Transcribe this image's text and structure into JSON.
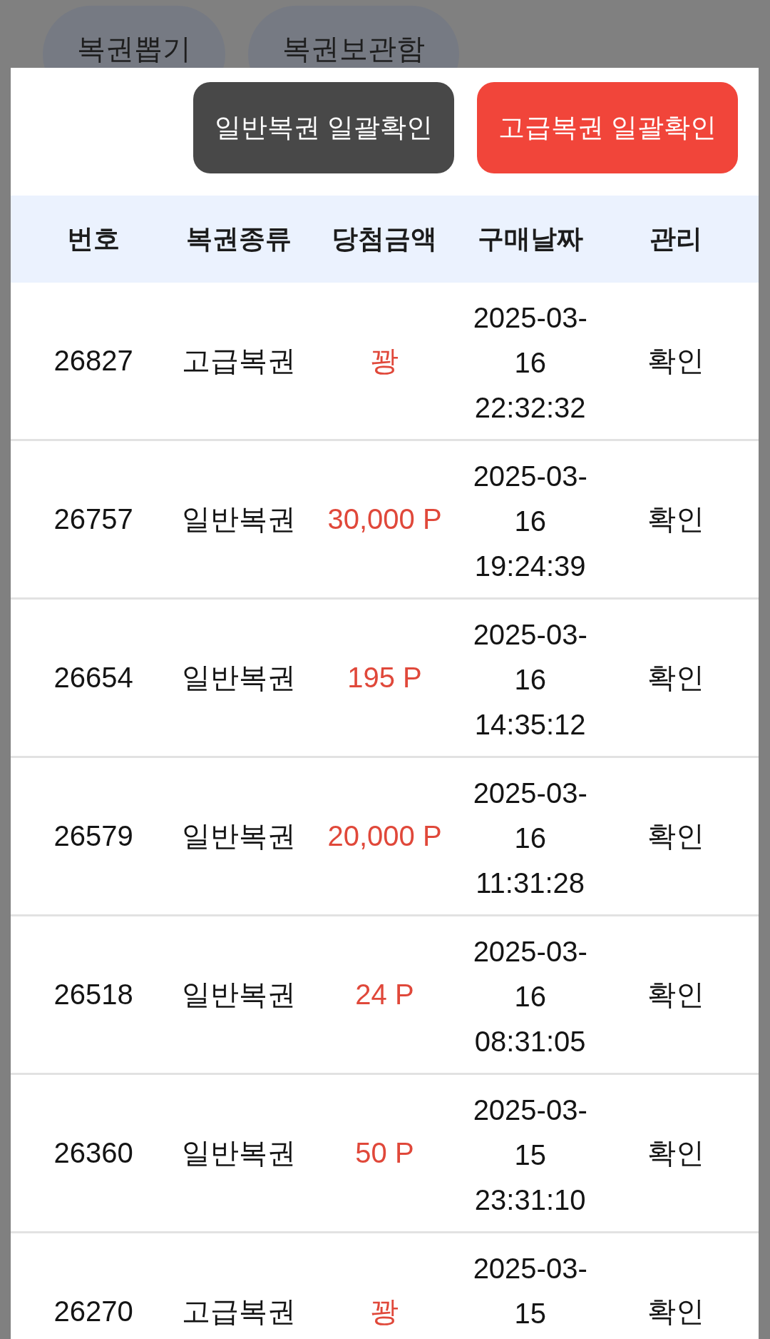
{
  "background_tabs": [
    {
      "label": "복권뽑기"
    },
    {
      "label": "복권보관함"
    }
  ],
  "modal": {
    "buttons": [
      {
        "label": "일반복권 일괄확인",
        "kind": "normal"
      },
      {
        "label": "고급복권 일괄확인",
        "kind": "premium"
      }
    ],
    "table": {
      "columns": [
        "번호",
        "복권종류",
        "당첨금액",
        "구매날짜",
        "관리"
      ],
      "rows": [
        {
          "number": "26827",
          "type": "고급복권",
          "prize": "꽝",
          "date": "2025-03-16 22:32:32",
          "action": "확인"
        },
        {
          "number": "26757",
          "type": "일반복권",
          "prize": "30,000 P",
          "date": "2025-03-16 19:24:39",
          "action": "확인"
        },
        {
          "number": "26654",
          "type": "일반복권",
          "prize": "195 P",
          "date": "2025-03-16 14:35:12",
          "action": "확인"
        },
        {
          "number": "26579",
          "type": "일반복권",
          "prize": "20,000 P",
          "date": "2025-03-16 11:31:28",
          "action": "확인"
        },
        {
          "number": "26518",
          "type": "일반복권",
          "prize": "24 P",
          "date": "2025-03-16 08:31:05",
          "action": "확인"
        },
        {
          "number": "26360",
          "type": "일반복권",
          "prize": "50 P",
          "date": "2025-03-15 23:31:10",
          "action": "확인"
        },
        {
          "number": "26270",
          "type": "고급복권",
          "prize": "꽝",
          "date": "2025-03-15",
          "action": "확인"
        }
      ]
    }
  }
}
